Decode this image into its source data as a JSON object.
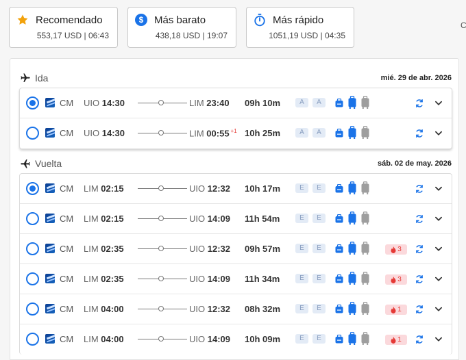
{
  "sort_options": [
    {
      "title": "Recomendado",
      "meta": "553,17 USD | 06:43",
      "icon": "star-icon"
    },
    {
      "title": "Más barato",
      "meta": "438,18 USD | 19:07",
      "icon": "dollar-icon"
    },
    {
      "title": "Más rápido",
      "meta": "1051,19 USD | 04:35",
      "icon": "stopwatch-icon"
    }
  ],
  "edge_text": "C",
  "colors": {
    "accent": "#1a73e8",
    "star": "#f2a20c",
    "baggage_included": "#1a73e8",
    "baggage_excluded": "#9e9e9e",
    "badge_bg": "#fbd9dc",
    "badge_text": "#e53935"
  },
  "ida": {
    "label": "Ida",
    "date": "mié. 29 de abr. 2026",
    "flights": [
      {
        "selected": true,
        "airline": "CM",
        "dep_code": "UIO",
        "dep_time": "14:30",
        "arr_code": "LIM",
        "arr_time": "23:40",
        "next_day": "",
        "duration": "09h 10m",
        "fare1": "A",
        "fare2": "A",
        "seats": ""
      },
      {
        "selected": false,
        "airline": "CM",
        "dep_code": "UIO",
        "dep_time": "14:30",
        "arr_code": "LIM",
        "arr_time": "00:55",
        "next_day": "+1",
        "duration": "10h 25m",
        "fare1": "A",
        "fare2": "A",
        "seats": ""
      }
    ]
  },
  "vuelta": {
    "label": "Vuelta",
    "date": "sáb. 02 de may. 2026",
    "flights": [
      {
        "selected": true,
        "airline": "CM",
        "dep_code": "LIM",
        "dep_time": "02:15",
        "arr_code": "UIO",
        "arr_time": "12:32",
        "next_day": "",
        "duration": "10h 17m",
        "fare1": "E",
        "fare2": "E",
        "seats": ""
      },
      {
        "selected": false,
        "airline": "CM",
        "dep_code": "LIM",
        "dep_time": "02:15",
        "arr_code": "UIO",
        "arr_time": "14:09",
        "next_day": "",
        "duration": "11h 54m",
        "fare1": "E",
        "fare2": "E",
        "seats": ""
      },
      {
        "selected": false,
        "airline": "CM",
        "dep_code": "LIM",
        "dep_time": "02:35",
        "arr_code": "UIO",
        "arr_time": "12:32",
        "next_day": "",
        "duration": "09h 57m",
        "fare1": "E",
        "fare2": "E",
        "seats": "3"
      },
      {
        "selected": false,
        "airline": "CM",
        "dep_code": "LIM",
        "dep_time": "02:35",
        "arr_code": "UIO",
        "arr_time": "14:09",
        "next_day": "",
        "duration": "11h 34m",
        "fare1": "E",
        "fare2": "E",
        "seats": "3"
      },
      {
        "selected": false,
        "airline": "CM",
        "dep_code": "LIM",
        "dep_time": "04:00",
        "arr_code": "UIO",
        "arr_time": "12:32",
        "next_day": "",
        "duration": "08h 32m",
        "fare1": "E",
        "fare2": "E",
        "seats": "1"
      },
      {
        "selected": false,
        "airline": "CM",
        "dep_code": "LIM",
        "dep_time": "04:00",
        "arr_code": "UIO",
        "arr_time": "14:09",
        "next_day": "",
        "duration": "10h 09m",
        "fare1": "E",
        "fare2": "E",
        "seats": "1"
      }
    ]
  }
}
